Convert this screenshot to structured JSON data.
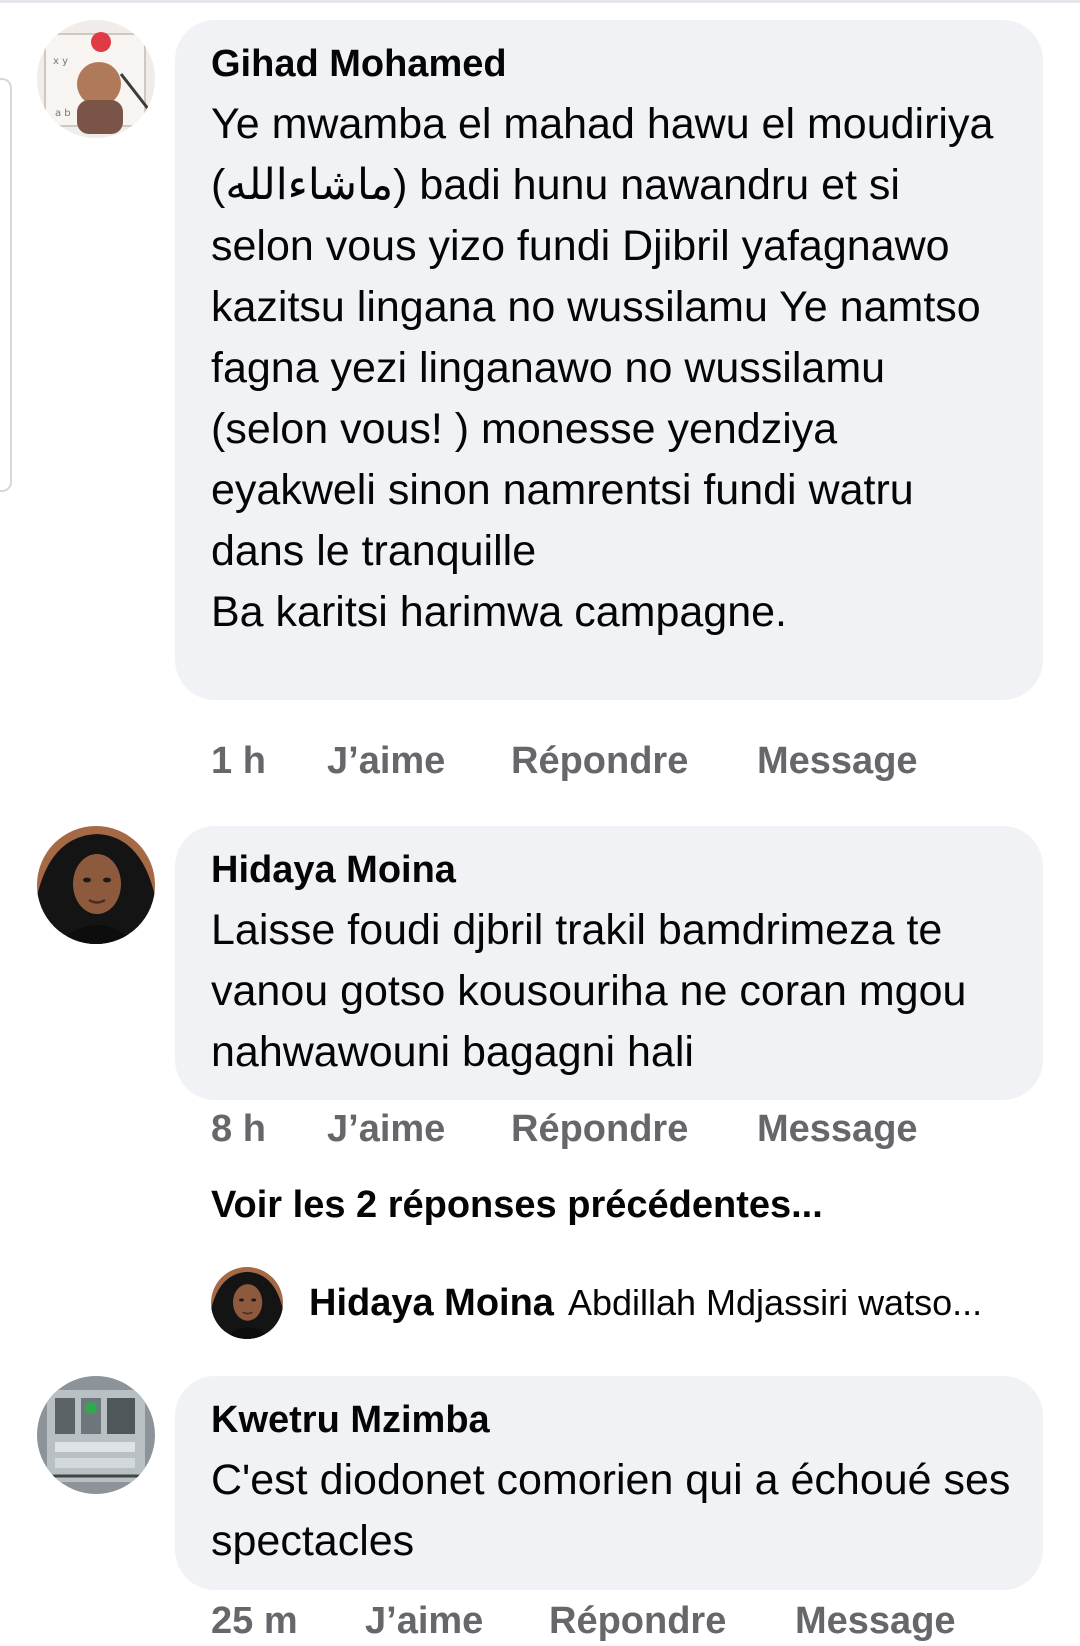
{
  "comments": [
    {
      "author": "Gihad Mohamed",
      "text": "Ye mwamba el mahad hawu el moudiriya (ماشاءالله) badi hunu nawandru et si selon vous yizo fundi Djibril yafagnawo kazitsu lingana no wussilamu Ye namtso fagna yezi linganawo no wussilamu (selon vous! ) monesse yendziya eyakweli sinon namrentsi fundi watru dans le tranquille\nBa karitsi harimwa campagne.",
      "time": "1 h",
      "like": "J’aime",
      "reply": "Répondre",
      "message": "Message"
    },
    {
      "author": "Hidaya Moina",
      "text": "Laisse foudi djbril trakil bamdrimeza te vanou gotso kousouriha ne coran mgou nahwawouni  bagagni hali",
      "time": "8 h",
      "like": "J’aime",
      "reply": "Répondre",
      "message": "Message",
      "previous_replies": "Voir les 2 réponses précédentes...",
      "latest_reply": {
        "author": "Hidaya Moina",
        "snippet": "Abdillah Mdjassiri watso..."
      }
    },
    {
      "author": "Kwetru Mzimba",
      "text": "C'est diodonet comorien qui a échoué ses spectacles",
      "time": "25 m",
      "like": "J’aime",
      "reply": "Répondre",
      "message": "Message"
    }
  ],
  "colors": {
    "bubble": "#f0f2f5",
    "text": "#050505",
    "meta": "#65676b"
  }
}
